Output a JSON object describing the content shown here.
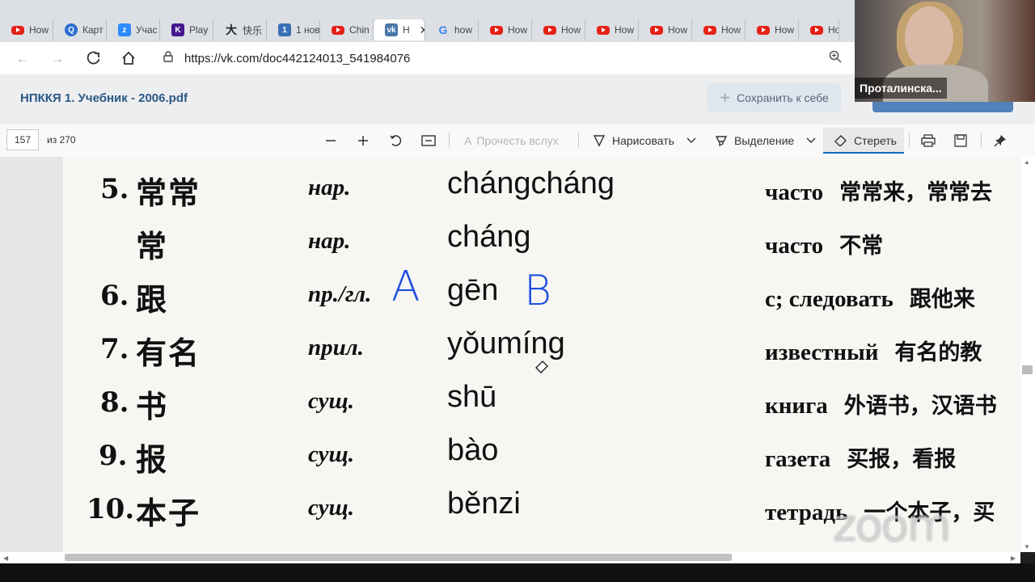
{
  "tabs": [
    {
      "label": "How",
      "icon": "youtube-icon"
    },
    {
      "label": "Карт",
      "icon": "quora-icon"
    },
    {
      "label": "Учас",
      "icon": "zoom-icon"
    },
    {
      "label": "Play",
      "icon": "kahoot-icon"
    },
    {
      "label": "快乐",
      "icon": "chinese-char-icon"
    },
    {
      "label": "1 нов",
      "icon": "one-icon"
    },
    {
      "label": "Chin",
      "icon": "youtube-icon"
    },
    {
      "label": "Н",
      "icon": "vk-icon",
      "active": true
    },
    {
      "label": "how",
      "icon": "google-icon"
    },
    {
      "label": "How",
      "icon": "youtube-icon"
    },
    {
      "label": "How",
      "icon": "youtube-icon"
    },
    {
      "label": "How",
      "icon": "youtube-icon"
    },
    {
      "label": "How",
      "icon": "youtube-icon"
    },
    {
      "label": "How",
      "icon": "youtube-icon"
    },
    {
      "label": "How",
      "icon": "youtube-icon"
    },
    {
      "label": "How",
      "icon": "youtube-icon"
    }
  ],
  "address": {
    "url": "https://vk.com/doc442124013_541984076"
  },
  "doc": {
    "title": "НПККЯ 1. Учебник - 2006.pdf",
    "save_label": "Сохранить к себе"
  },
  "pdf_toolbar": {
    "page": "157",
    "page_count": "из 270",
    "read_aloud": "Прочесть вслух",
    "draw": "Нарисовать",
    "highlight": "Выделение",
    "erase": "Стереть"
  },
  "page_content": {
    "rows": [
      {
        "num": "5.",
        "hanzi": "常常",
        "pos": "нар.",
        "pinyin": "chángcháng",
        "meaning": "часто",
        "example": "常常来，常常去"
      },
      {
        "num": "",
        "hanzi": "常",
        "pos": "нар.",
        "pinyin": "cháng",
        "meaning": "часто",
        "example": "不常"
      },
      {
        "num": "6.",
        "hanzi": "跟",
        "pos": "пр./гл.",
        "pinyin": "gēn",
        "meaning": "с; следовать",
        "example": "跟他来"
      },
      {
        "num": "7.",
        "hanzi": "有名",
        "pos": "прил.",
        "pinyin": "yǒumíng",
        "meaning": "известный",
        "example": "有名的教"
      },
      {
        "num": "8.",
        "hanzi": "书",
        "pos": "сущ.",
        "pinyin": "shū",
        "meaning": "книга",
        "example": "外语书，汉语书"
      },
      {
        "num": "9.",
        "hanzi": "报",
        "pos": "сущ.",
        "pinyin": "bào",
        "meaning": "газета",
        "example": "买报，看报"
      },
      {
        "num": "10.",
        "hanzi": "本子",
        "pos": "сущ.",
        "pinyin": "běnzi",
        "meaning": "тетрадь",
        "example": "一个本子，买"
      }
    ],
    "annotations": [
      "A",
      "B"
    ]
  },
  "video": {
    "participant_name": "Проталинска..."
  },
  "watermark": "zoom"
}
